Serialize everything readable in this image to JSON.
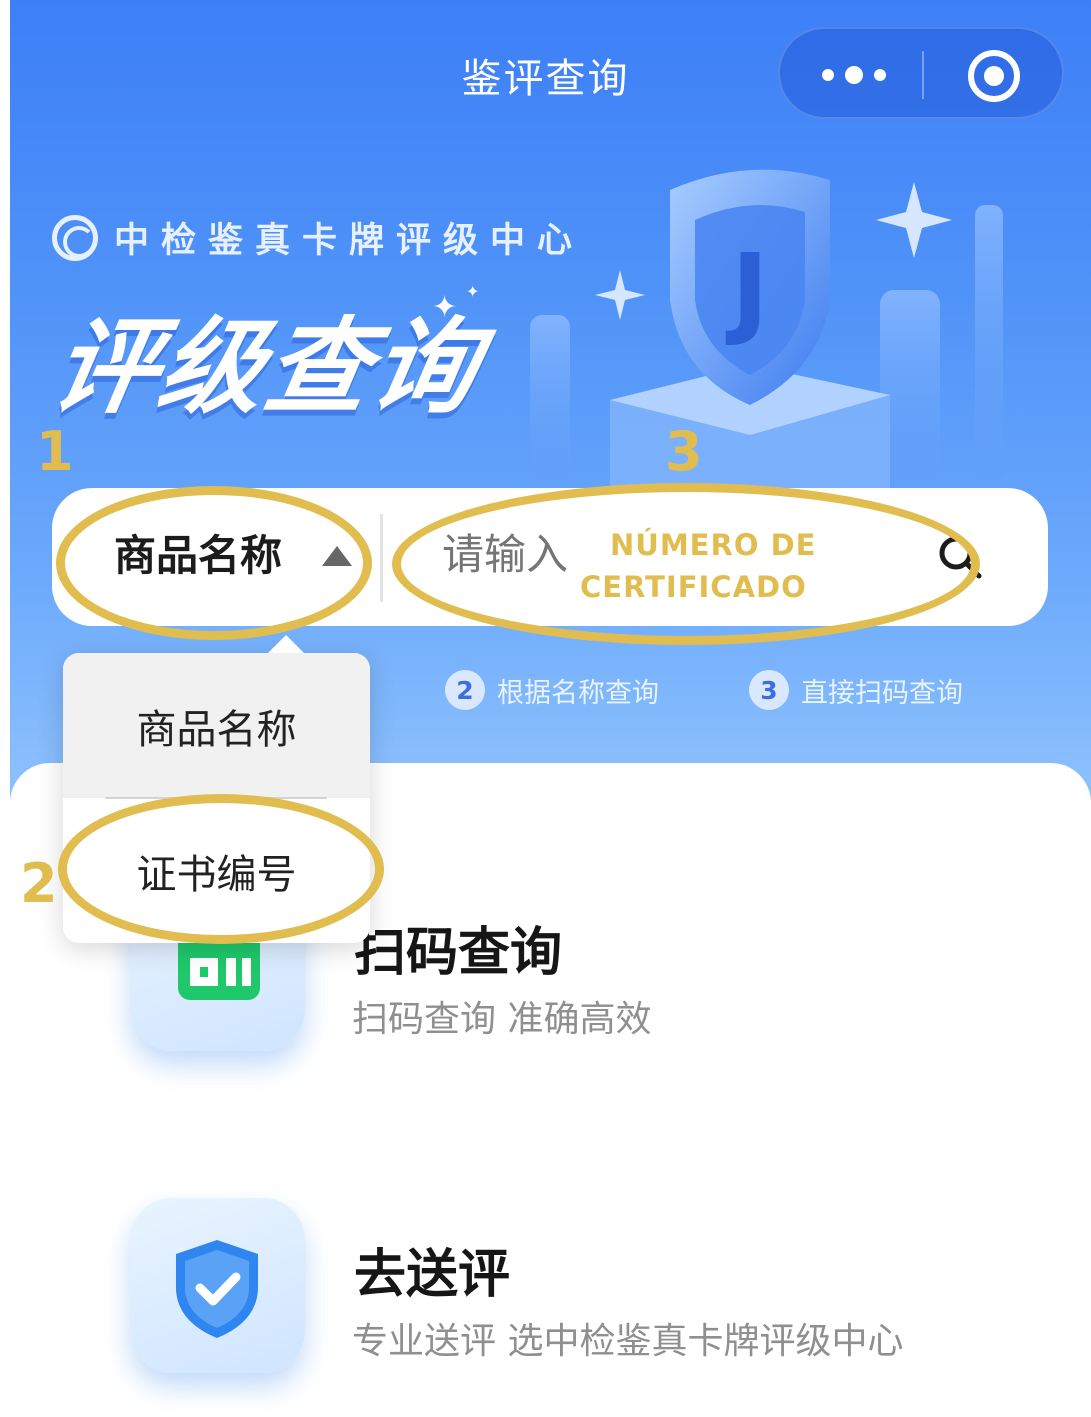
{
  "nav": {
    "title": "鉴评查询"
  },
  "brand": {
    "name": "中检鉴真卡牌评级中心",
    "hero_title": "评级查询"
  },
  "search": {
    "select_label": "商品名称",
    "placeholder": "请输入",
    "options": [
      "商品名称",
      "证书编号"
    ]
  },
  "hints": [
    {
      "num": "2",
      "text": "根据名称查询"
    },
    {
      "num": "3",
      "text": "直接扫码查询"
    }
  ],
  "cards": [
    {
      "title": "扫码查询",
      "subtitle": "扫码查询 准确高效"
    },
    {
      "title": "去送评",
      "subtitle": "专业送评 选中检鉴真卡牌评级中心"
    }
  ],
  "annotations": {
    "marker_1": "1",
    "marker_2": "2",
    "marker_3": "3",
    "cert_line1": "NÚMERO DE",
    "cert_line2": "CERTIFICADO",
    "color": "#e1bd50"
  },
  "colors": {
    "banner_top": "#3d7ff7",
    "banner_bottom": "#8ec2fd",
    "scan_green": "#1fc96b",
    "shield_blue": "#2f86f0"
  }
}
